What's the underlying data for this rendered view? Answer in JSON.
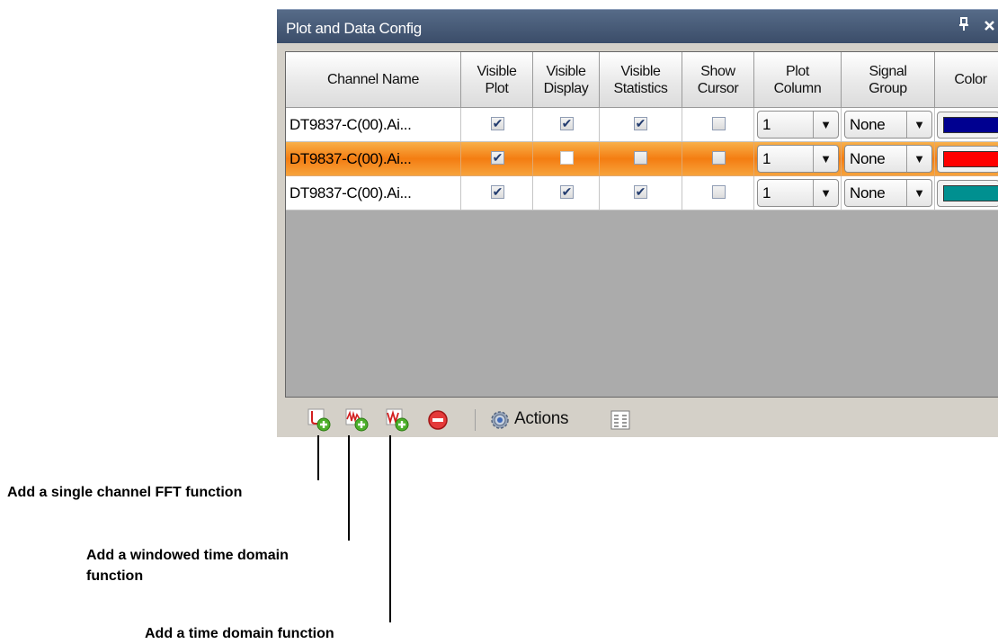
{
  "panel": {
    "title": "Plot and Data Config",
    "pin_glyph": "ᴪ",
    "close_glyph": "×"
  },
  "columns": [
    "Channel Name",
    "Visible\nPlot",
    "Visible\nDisplay",
    "Visible\nStatistics",
    "Show\nCursor",
    "Plot\nColumn",
    "Signal\nGroup",
    "Color"
  ],
  "rows": [
    {
      "name": "DT9837-C(00).Ai...",
      "visible_plot": true,
      "visible_display": true,
      "visible_statistics": true,
      "show_cursor": false,
      "plot_column": "1",
      "signal_group": "None",
      "color": "#000090",
      "selected": false
    },
    {
      "name": "DT9837-C(00).Ai...",
      "visible_plot": true,
      "visible_display": false,
      "visible_statistics": false,
      "show_cursor": false,
      "plot_column": "1",
      "signal_group": "None",
      "color": "#ff0000",
      "selected": true
    },
    {
      "name": "DT9837-C(00).Ai...",
      "visible_plot": true,
      "visible_display": true,
      "visible_statistics": true,
      "show_cursor": false,
      "plot_column": "1",
      "signal_group": "None",
      "color": "#009090",
      "selected": false
    }
  ],
  "toolbar": {
    "actions_label": "Actions",
    "icons": [
      "fft-function-add-icon",
      "windowed-time-function-add-icon",
      "time-function-add-icon",
      "remove-icon",
      "gear-icon",
      "columns-icon"
    ]
  },
  "annotations": {
    "fft": "Add a single channel FFT function",
    "windowed": "Add a windowed time domain\nfunction",
    "time": "Add a time domain function"
  }
}
